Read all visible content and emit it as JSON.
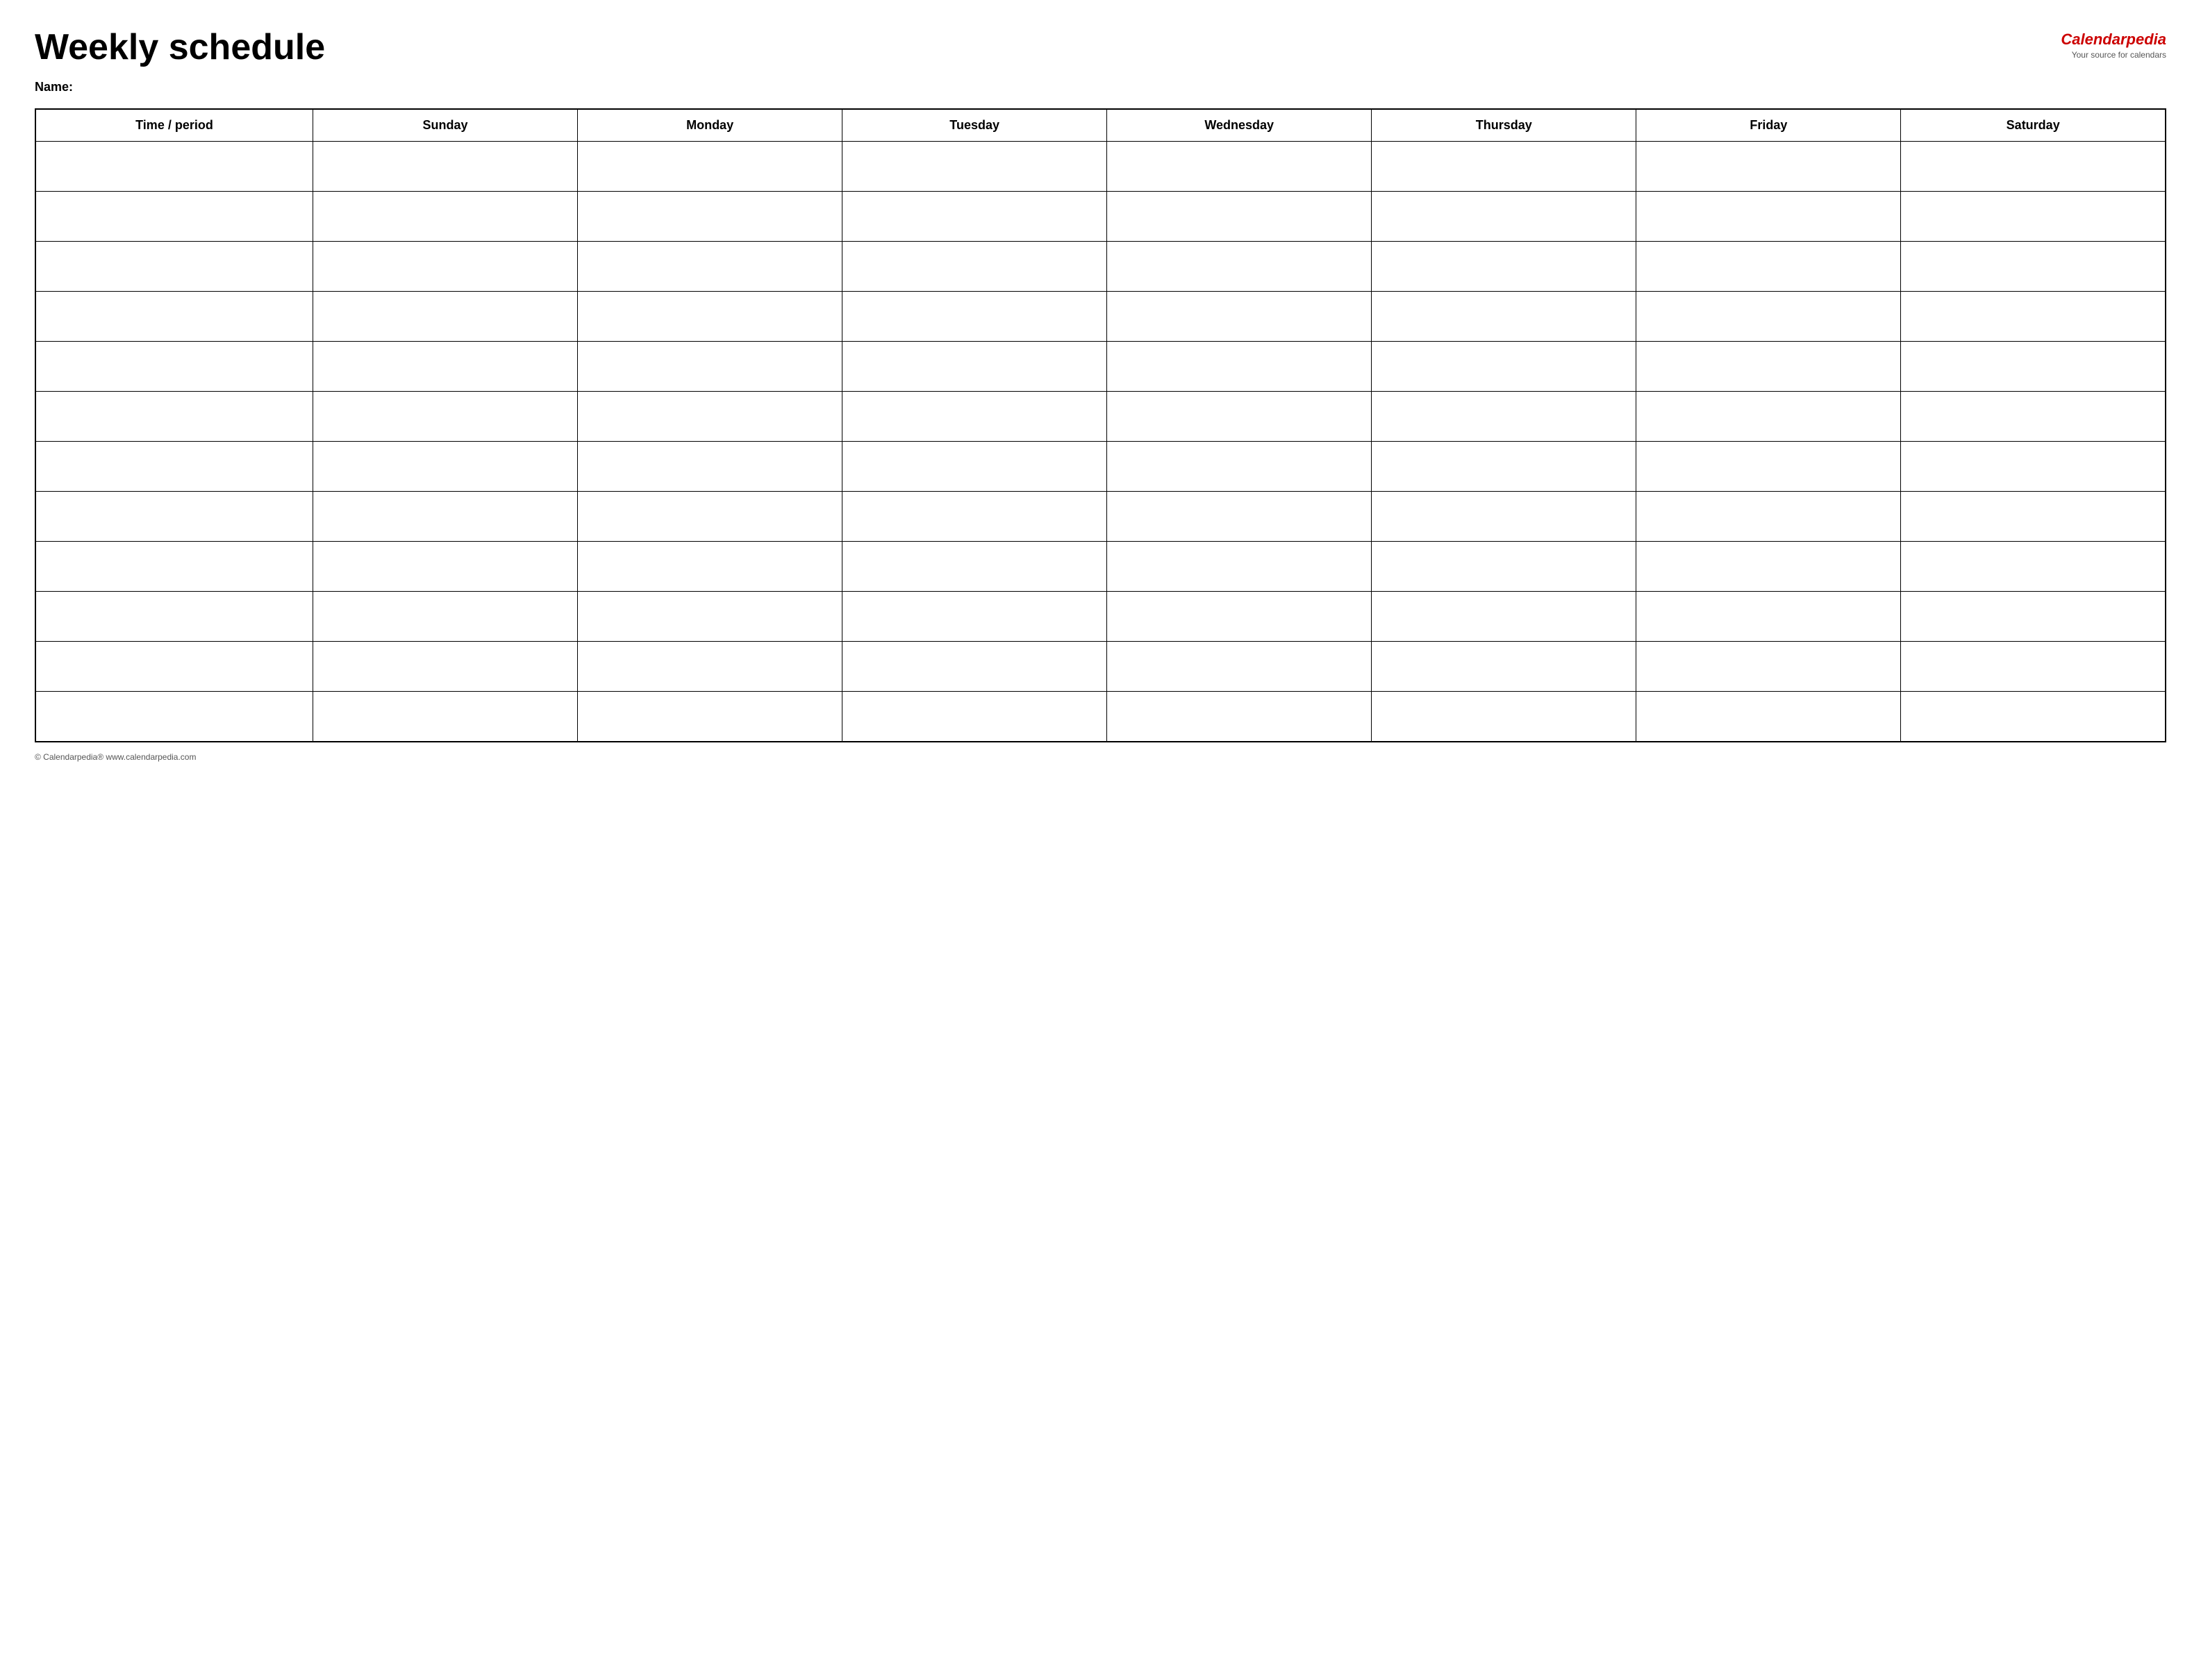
{
  "header": {
    "title": "Weekly schedule",
    "brand": {
      "prefix": "Calendar",
      "suffix": "pedia",
      "tagline": "Your source for calendars"
    }
  },
  "name_label": "Name:",
  "table": {
    "headers": [
      "Time / period",
      "Sunday",
      "Monday",
      "Tuesday",
      "Wednesday",
      "Thursday",
      "Friday",
      "Saturday"
    ],
    "row_count": 12
  },
  "footer": {
    "text": "© Calendarpedia®  www.calendarpedia.com"
  }
}
